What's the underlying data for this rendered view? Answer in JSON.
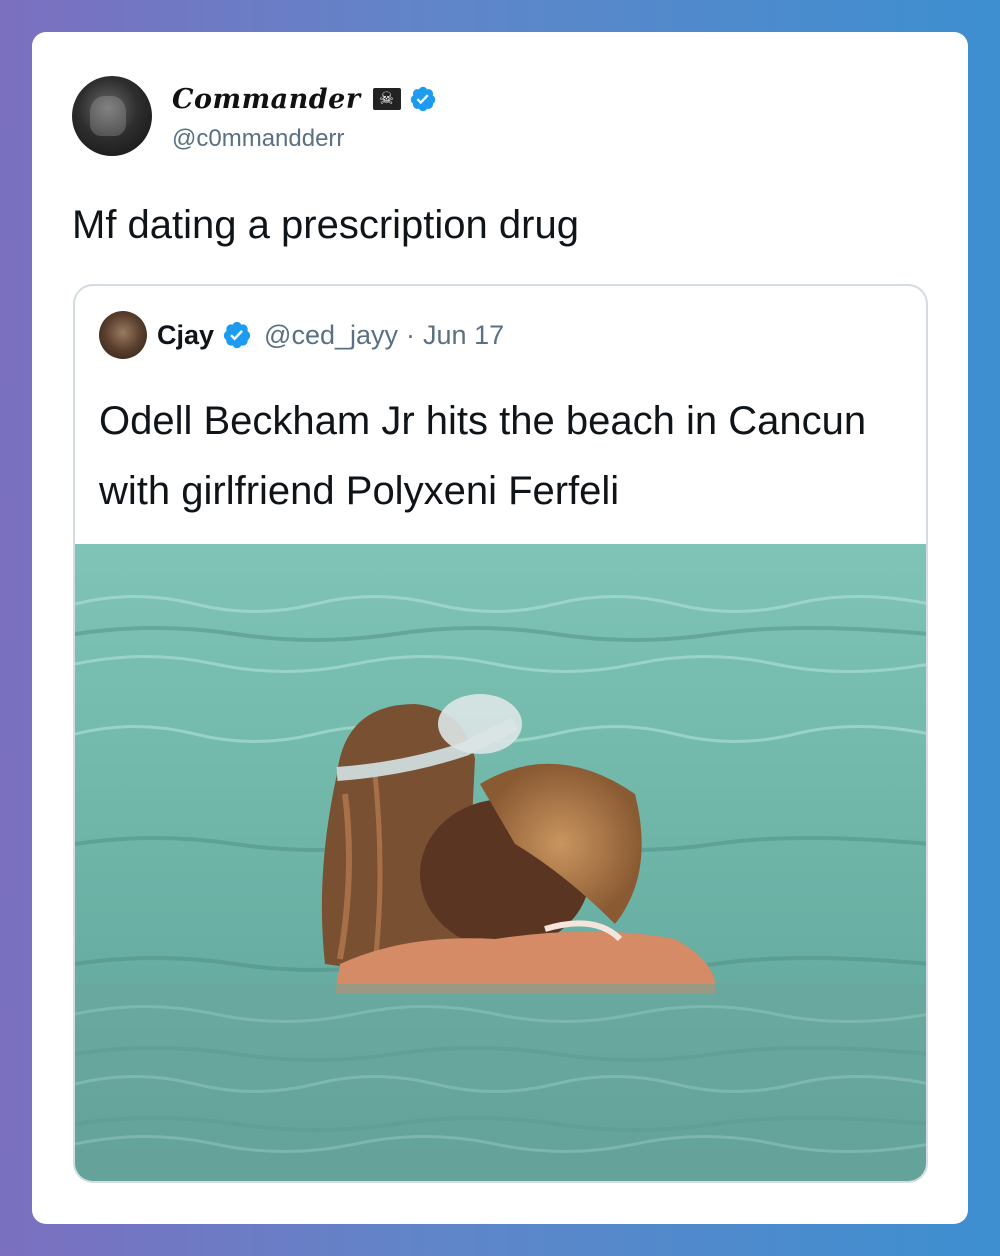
{
  "tweet": {
    "author": {
      "display_name": "Commander",
      "flag_emoji": "🏴‍☠️",
      "handle": "@c0mmandderr",
      "verified": true
    },
    "text": "Mf dating a prescription drug"
  },
  "quoted_tweet": {
    "author": {
      "display_name": "Cjay",
      "handle": "@ced_jayy",
      "verified": true
    },
    "separator": "·",
    "date": "Jun 17",
    "text": "Odell Beckham Jr hits the beach in Cancun with girlfriend Polyxeni Ferfeli",
    "photo": {
      "icon": "beach-photo",
      "water_color": "#6fb8ab"
    }
  },
  "colors": {
    "verified_blue": "#1d9bf0",
    "secondary_text": "#5b7083",
    "border": "#d4dbe1"
  }
}
